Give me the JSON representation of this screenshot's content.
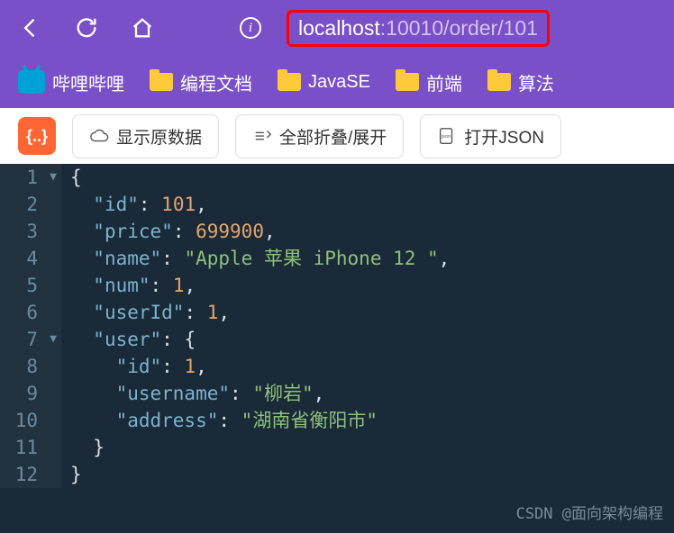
{
  "url": {
    "host": "localhost",
    "rest": ":10010/order/101"
  },
  "bookmarks": {
    "bili": "哔哩哔哩",
    "docs": "编程文档",
    "javase": "JavaSE",
    "frontend": "前端",
    "algo": "算法"
  },
  "toolbar": {
    "badge": "{..}",
    "raw": "显示原数据",
    "collapse": "全部折叠/展开",
    "open_json": "打开JSON"
  },
  "code": {
    "l1": "{",
    "l2_k": "\"id\"",
    "l2_v": "101",
    "l3_k": "\"price\"",
    "l3_v": "699900",
    "l4_k": "\"name\"",
    "l4_v": "\"Apple 苹果 iPhone 12 \"",
    "l5_k": "\"num\"",
    "l5_v": "1",
    "l6_k": "\"userId\"",
    "l6_v": "1",
    "l7_k": "\"user\"",
    "l8_k": "\"id\"",
    "l8_v": "1",
    "l9_k": "\"username\"",
    "l9_v": "\"柳岩\"",
    "l10_k": "\"address\"",
    "l10_v": "\"湖南省衡阳市\""
  },
  "watermark": "CSDN @面向架构编程"
}
